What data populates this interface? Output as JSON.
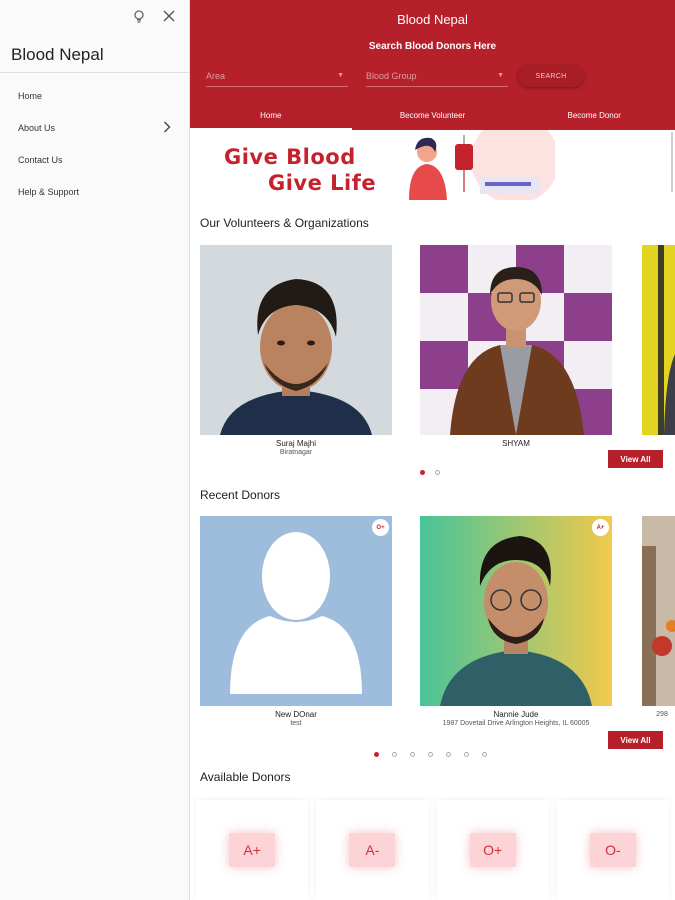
{
  "drawer": {
    "title": "Blood Nepal",
    "items": [
      {
        "label": "Home"
      },
      {
        "label": "About Us",
        "expandable": true
      },
      {
        "label": "Contact Us"
      },
      {
        "label": "Help & Support"
      }
    ]
  },
  "header": {
    "app_title": "Blood Nepal",
    "search_title": "Search Blood Donors Here",
    "area_placeholder": "Area",
    "group_placeholder": "Blood Group",
    "search_button": "SEARCH",
    "tabs": [
      {
        "label": "Home",
        "active": true
      },
      {
        "label": "Become Volunteer",
        "active": false
      },
      {
        "label": "Become Donor",
        "active": false
      }
    ]
  },
  "banner": {
    "line1": "Give Blood",
    "line2": "Give Life"
  },
  "volunteers": {
    "title": "Our Volunteers & Organizations",
    "cards": [
      {
        "name": "Suraj Majhi",
        "sub": "Biratnagar"
      },
      {
        "name": "SHYAM",
        "sub": ""
      }
    ],
    "dots": 2,
    "active_dot": 0,
    "view_all": "View All"
  },
  "recent": {
    "title": "Recent Donors",
    "cards": [
      {
        "name": "New DOnar",
        "sub": "test",
        "group": "O+"
      },
      {
        "name": "Nannie Jude",
        "sub": "1987 Dovetail Drive Arlington Heights, IL 60005",
        "group": "A+"
      },
      {
        "name": "",
        "sub": "298",
        "group": ""
      }
    ],
    "dots": 7,
    "active_dot": 0,
    "view_all": "View All"
  },
  "available": {
    "title": "Available Donors",
    "groups": [
      "A+",
      "A-",
      "O+",
      "O-"
    ]
  },
  "colors": {
    "primary": "#b5202a",
    "accent_text": "#c5222e",
    "chip_bg": "#fcd3d6"
  }
}
